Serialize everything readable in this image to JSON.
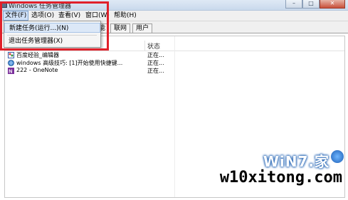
{
  "window": {
    "title": "Windows 任务管理器",
    "controls": {
      "minimize": "–",
      "maximize": "□",
      "close": "✕"
    }
  },
  "menubar": {
    "items": [
      "文件(F)",
      "选项(O)",
      "查看(V)",
      "窗口(W)",
      "帮助(H)"
    ]
  },
  "tabs": {
    "items": [
      "能",
      "联网",
      "用户"
    ]
  },
  "file_menu": {
    "items": [
      "新建任务(运行...)(N)",
      "退出任务管理器(X)"
    ]
  },
  "task_list": {
    "header": {
      "status": "状态"
    },
    "rows": [
      {
        "name": "百度经验_编辑器",
        "status": "正在...",
        "icon": "paint-icon"
      },
      {
        "name": "windows 高级技巧: [1]开始使用快捷键...",
        "status": "正在...",
        "icon": "globe-icon"
      },
      {
        "name": "222 - OneNote",
        "status": "正在...",
        "icon": "onenote-icon"
      }
    ]
  },
  "watermark": {
    "logo": "WiN7.家",
    "url": "w10xitong.com"
  }
}
